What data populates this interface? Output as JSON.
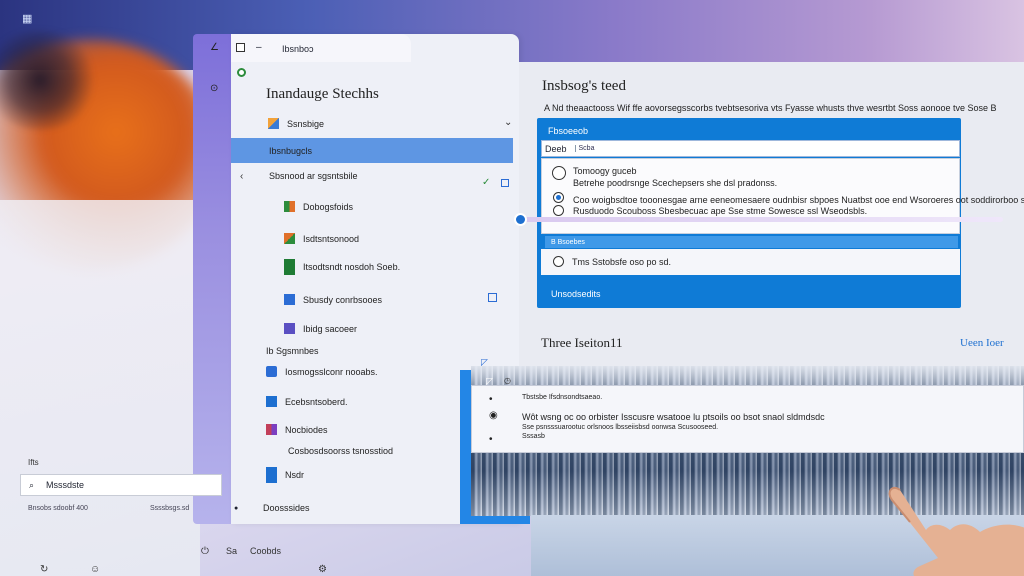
{
  "window": {
    "tab_title": "Ibsnboɔ",
    "panel_title": "Inandauge Stechhs"
  },
  "nav": {
    "items": [
      {
        "label": "Ssnsbige",
        "color": "#3a7bd5"
      },
      {
        "label": "Ibsnbugcls",
        "color": ""
      },
      {
        "label": "Sbsnood ar sgsntsbile",
        "color": ""
      },
      {
        "label": "Dobogsfoids",
        "color": "#2c8c3c"
      },
      {
        "label": "Isdtsntsonood",
        "color": "#e0702a"
      },
      {
        "label": "Itsodtsndt nosdoh Soeb.",
        "color": "#1e7b34"
      },
      {
        "label": "Sbusdy conrbsooes",
        "color": "#2b6cd4"
      },
      {
        "label": "Ibidg sacoeer",
        "color": "#5a4fc2"
      },
      {
        "label": "Ib Sgsmnbes",
        "color": ""
      },
      {
        "label": "Iosmogsslconr nooabs.",
        "color": "#2b6cd4"
      },
      {
        "label": "Ecebsntsoberd.",
        "color": "#1d6fd0"
      },
      {
        "label": "Nocbiodes",
        "color": "#7a3fc0"
      },
      {
        "label": "Cosbosdsoorss tsnosstiod",
        "color": ""
      },
      {
        "label": "Nsdr",
        "color": "#1d6fd0"
      },
      {
        "label": "Doosssides",
        "color": ""
      }
    ]
  },
  "search": {
    "label": "Ifts",
    "value": "Msssdste",
    "sub_left": "Bnsobs sdoobf 400",
    "sub_right": "Ssssbsgs.sd"
  },
  "bottom_bar": {
    "label1": "Sa",
    "label2": "Coobds"
  },
  "main": {
    "title": "Insbsog's teed",
    "description": "A Nd theaactooss Wif ffe aovorsegsscorbs tvebtsesoriva vts Fyasse whusts thve wesrtbt Soss aonooe tve Sose B",
    "card": {
      "header": "Fbsoeeob",
      "input_value": "Deeb",
      "input_chip": "Scba",
      "options": [
        {
          "text": "Tomoogy guceb",
          "checked": false
        },
        {
          "text": "Betrehe poodrsnge   Scechepsers she dsl pradonss.",
          "checked": false
        },
        {
          "text": "Coo woigbsdtoe tooonesgae arne eeneomesaere  oudnbisr sbpoes Nuatbst ooe end Wsoroeres oot soddirorboo sbeede",
          "checked": true
        },
        {
          "text": "Rusduodo Scouboss  Sbesbecuac ape  Sse stme Sowesce ssl Wseodsbls.",
          "checked": false
        }
      ],
      "bar_label": "B  Bsoebes",
      "last_option": "Tms Sstobsfe oso po sd.",
      "footer": "Unsodsedits"
    },
    "section_title": "Three Iseiton11",
    "section_link": "Ueen Ioer"
  },
  "notice": {
    "title": "Tbstsbe Ifsdnsondtsaeao.",
    "line1": "Wôt wsng oc oo orbister Isscusre wsatooe lu ptsoils oo bsot snaol sldmdsdc",
    "line2": "Sse psnsssuarootuc orlsnoos lbsseiisbsd oonwsa Scusooseed.",
    "line3": "Sssasb"
  }
}
